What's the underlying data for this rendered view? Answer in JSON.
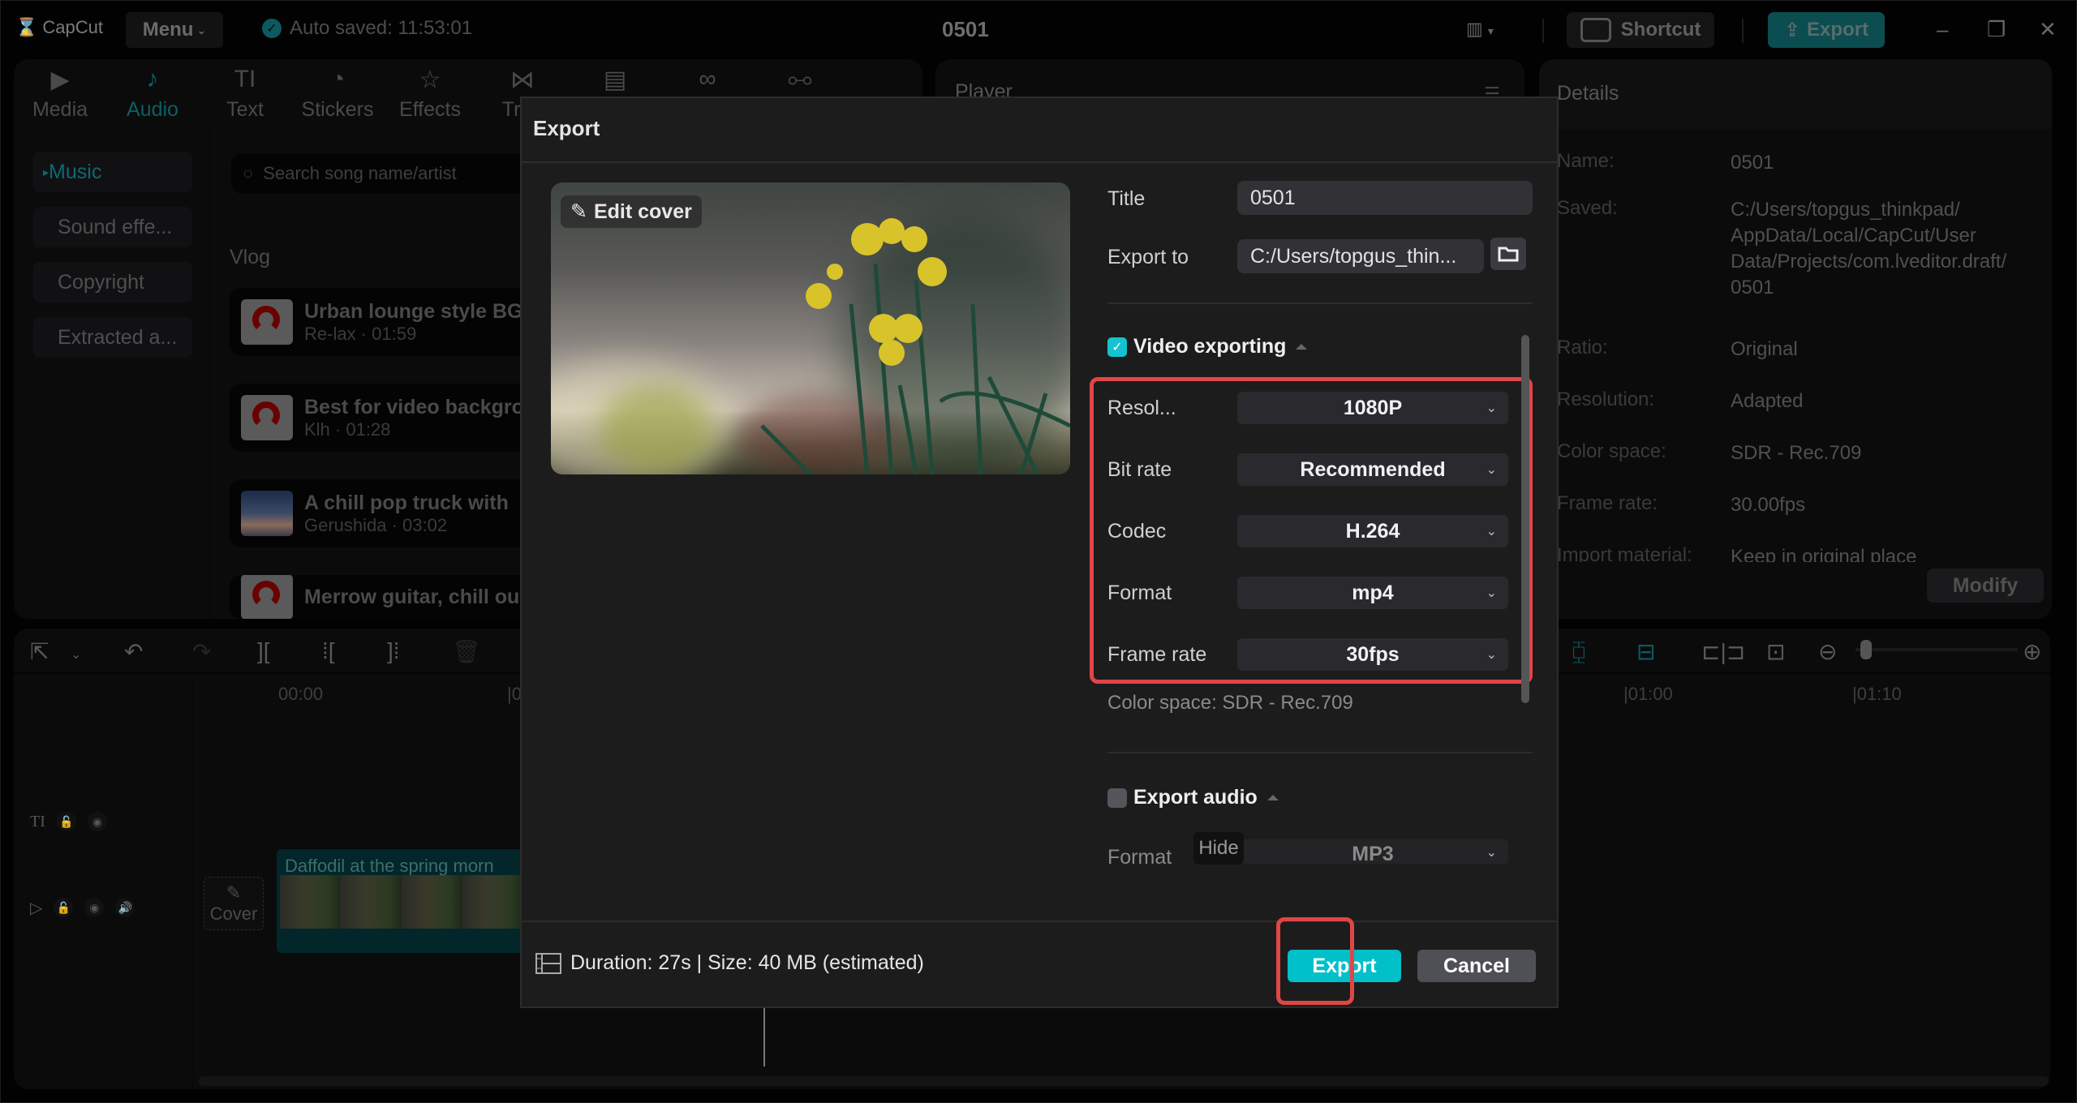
{
  "app": {
    "logo": "CapCut",
    "menu_label": "Menu",
    "autosave_text": "Auto saved: 11:53:01",
    "project_title": "0501",
    "shortcut_label": "Shortcut",
    "export_label": "Export",
    "accent_color": "#00c0c9",
    "highlight_color": "#e04646"
  },
  "media_tabs": [
    {
      "label": "Media",
      "icon": "media-icon",
      "glyph": "▶"
    },
    {
      "label": "Audio",
      "icon": "audio-icon",
      "glyph": "♪",
      "active": true
    },
    {
      "label": "Text",
      "icon": "text-icon",
      "glyph": "TI"
    },
    {
      "label": "Stickers",
      "icon": "sticker-icon",
      "glyph": "◔"
    },
    {
      "label": "Effects",
      "icon": "effects-icon",
      "glyph": "☆"
    },
    {
      "label": "Tran",
      "icon": "transition-icon",
      "glyph": "⋈"
    },
    {
      "label": "",
      "icon": "captions-icon",
      "glyph": "▤"
    },
    {
      "label": "",
      "icon": "filters-icon",
      "glyph": "∞"
    },
    {
      "label": "",
      "icon": "adjust-icon",
      "glyph": "⧟"
    }
  ],
  "audio_sidebar": [
    "Music",
    "Sound effe...",
    "Copyright",
    "Extracted a..."
  ],
  "search": {
    "placeholder": "Search song name/artist"
  },
  "category": "Vlog",
  "songs": [
    {
      "title": "Urban lounge style BG",
      "meta": "Re-lax · 01:59"
    },
    {
      "title": "Best for video backgro",
      "meta": "Klh · 01:28"
    },
    {
      "title": "A chill pop truck with",
      "meta": "Gerushida · 03:02"
    },
    {
      "title": "Merrow guitar, chill ou",
      "meta": ""
    }
  ],
  "player": {
    "label": "Player"
  },
  "details": {
    "header": "Details",
    "rows": [
      {
        "key": "Name:",
        "value": "0501"
      },
      {
        "key": "Saved:",
        "value": "C:/Users/topgus_thinkpad/ AppData/Local/CapCut/User Data/Projects/com.lveditor.draft/ 0501"
      },
      {
        "key": "Ratio:",
        "value": "Original"
      },
      {
        "key": "Resolution:",
        "value": "Adapted"
      },
      {
        "key": "Color space:",
        "value": "SDR - Rec.709"
      },
      {
        "key": "Frame rate:",
        "value": "30.00fps"
      },
      {
        "key": "Import material:",
        "value": "Keep in original place"
      }
    ],
    "modify_label": "Modify"
  },
  "timeline": {
    "ruler": [
      "00:00",
      "|0",
      "|01:00",
      "|01:10"
    ],
    "clip_name": "Daffodil at the spring morn",
    "cover_label": "Cover"
  },
  "export_dialog": {
    "title": "Export",
    "edit_cover": "Edit cover",
    "title_label": "Title",
    "title_value": "0501",
    "export_to_label": "Export to",
    "export_to_value": "C:/Users/topgus_thin...",
    "video_section": {
      "label": "Video exporting",
      "checked": true
    },
    "settings": [
      {
        "label": "Resol...",
        "value": "1080P"
      },
      {
        "label": "Bit rate",
        "value": "Recommended"
      },
      {
        "label": "Codec",
        "value": "H.264"
      },
      {
        "label": "Format",
        "value": "mp4"
      },
      {
        "label": "Frame rate",
        "value": "30fps"
      }
    ],
    "color_space": "Color space: SDR - Rec.709",
    "audio_section": {
      "label": "Export audio",
      "checked": false
    },
    "audio_format_label": "Format",
    "audio_format_value": "MP3",
    "hide_tooltip": "Hide",
    "footer_info": "Duration: 27s | Size: 40 MB (estimated)",
    "export_button": "Export",
    "cancel_button": "Cancel"
  }
}
